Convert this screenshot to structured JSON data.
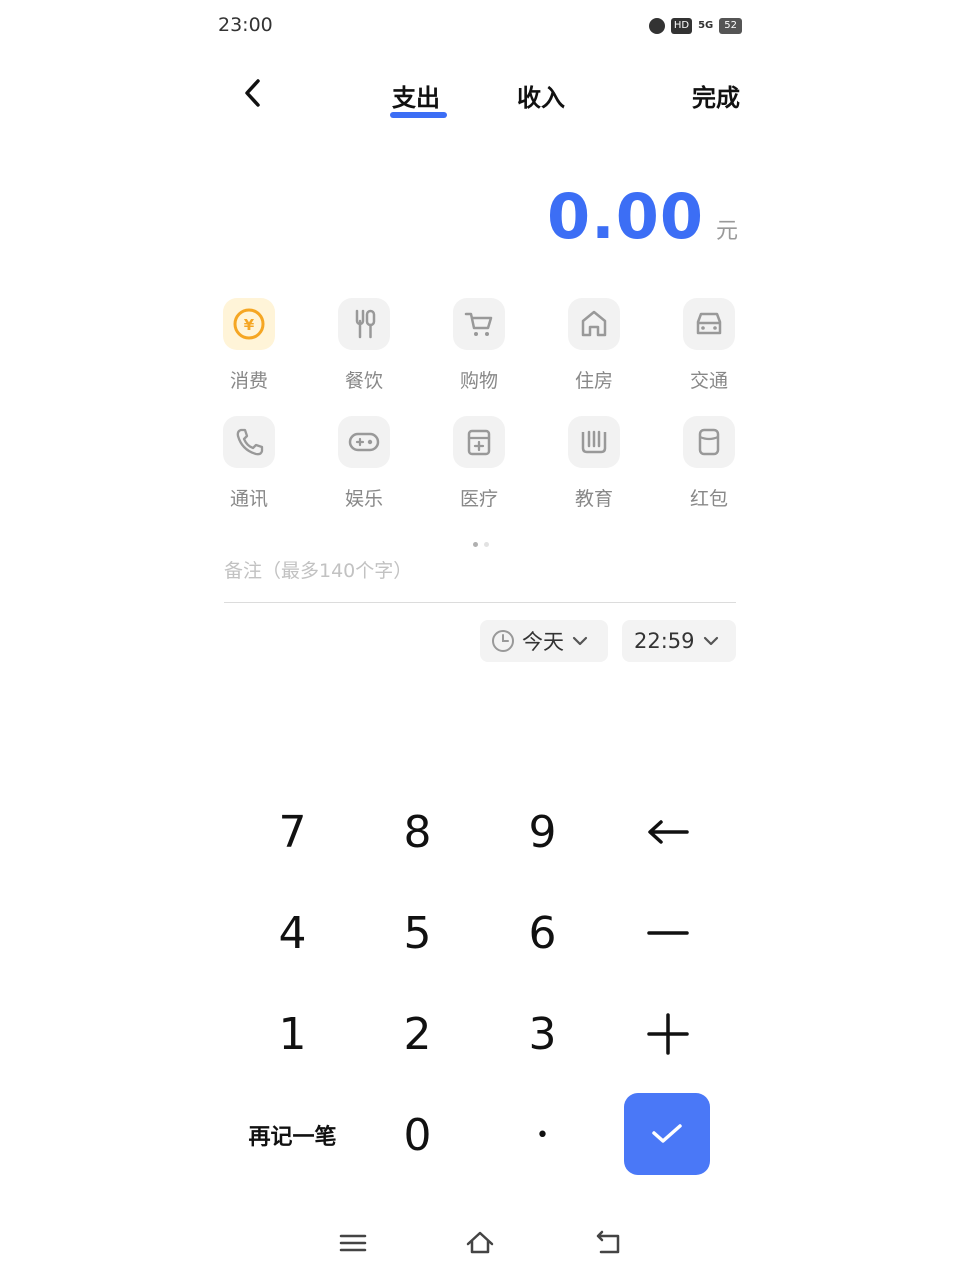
{
  "status_bar": {
    "time": "23:00",
    "network": "5G",
    "hd": "HD",
    "battery": "52"
  },
  "header": {
    "tab_expense": "支出",
    "tab_income": "收入",
    "done": "完成"
  },
  "amount": {
    "value": "0.00",
    "unit": "元"
  },
  "categories": [
    {
      "label": "消费",
      "icon": "yuan-coin-icon",
      "active": true
    },
    {
      "label": "餐饮",
      "icon": "utensils-icon"
    },
    {
      "label": "购物",
      "icon": "cart-icon"
    },
    {
      "label": "住房",
      "icon": "house-icon"
    },
    {
      "label": "交通",
      "icon": "car-icon"
    },
    {
      "label": "通讯",
      "icon": "phone-icon"
    },
    {
      "label": "娱乐",
      "icon": "gamepad-icon"
    },
    {
      "label": "医疗",
      "icon": "medical-kit-icon"
    },
    {
      "label": "教育",
      "icon": "books-icon"
    },
    {
      "label": "红包",
      "icon": "red-envelope-icon"
    }
  ],
  "note": {
    "placeholder": "备注（最多140个字）"
  },
  "date_chip": {
    "label": "今天"
  },
  "time_chip": {
    "label": "22:59"
  },
  "keypad": {
    "row1": [
      "7",
      "8",
      "9",
      "←"
    ],
    "row2": [
      "4",
      "5",
      "6",
      "−"
    ],
    "row3": [
      "1",
      "2",
      "3",
      "+"
    ],
    "row4": [
      "再记一笔",
      "0",
      "•"
    ]
  },
  "colors": {
    "accent": "#3c6ef5",
    "confirm": "#4a78f7",
    "coin": "#f5a623"
  }
}
